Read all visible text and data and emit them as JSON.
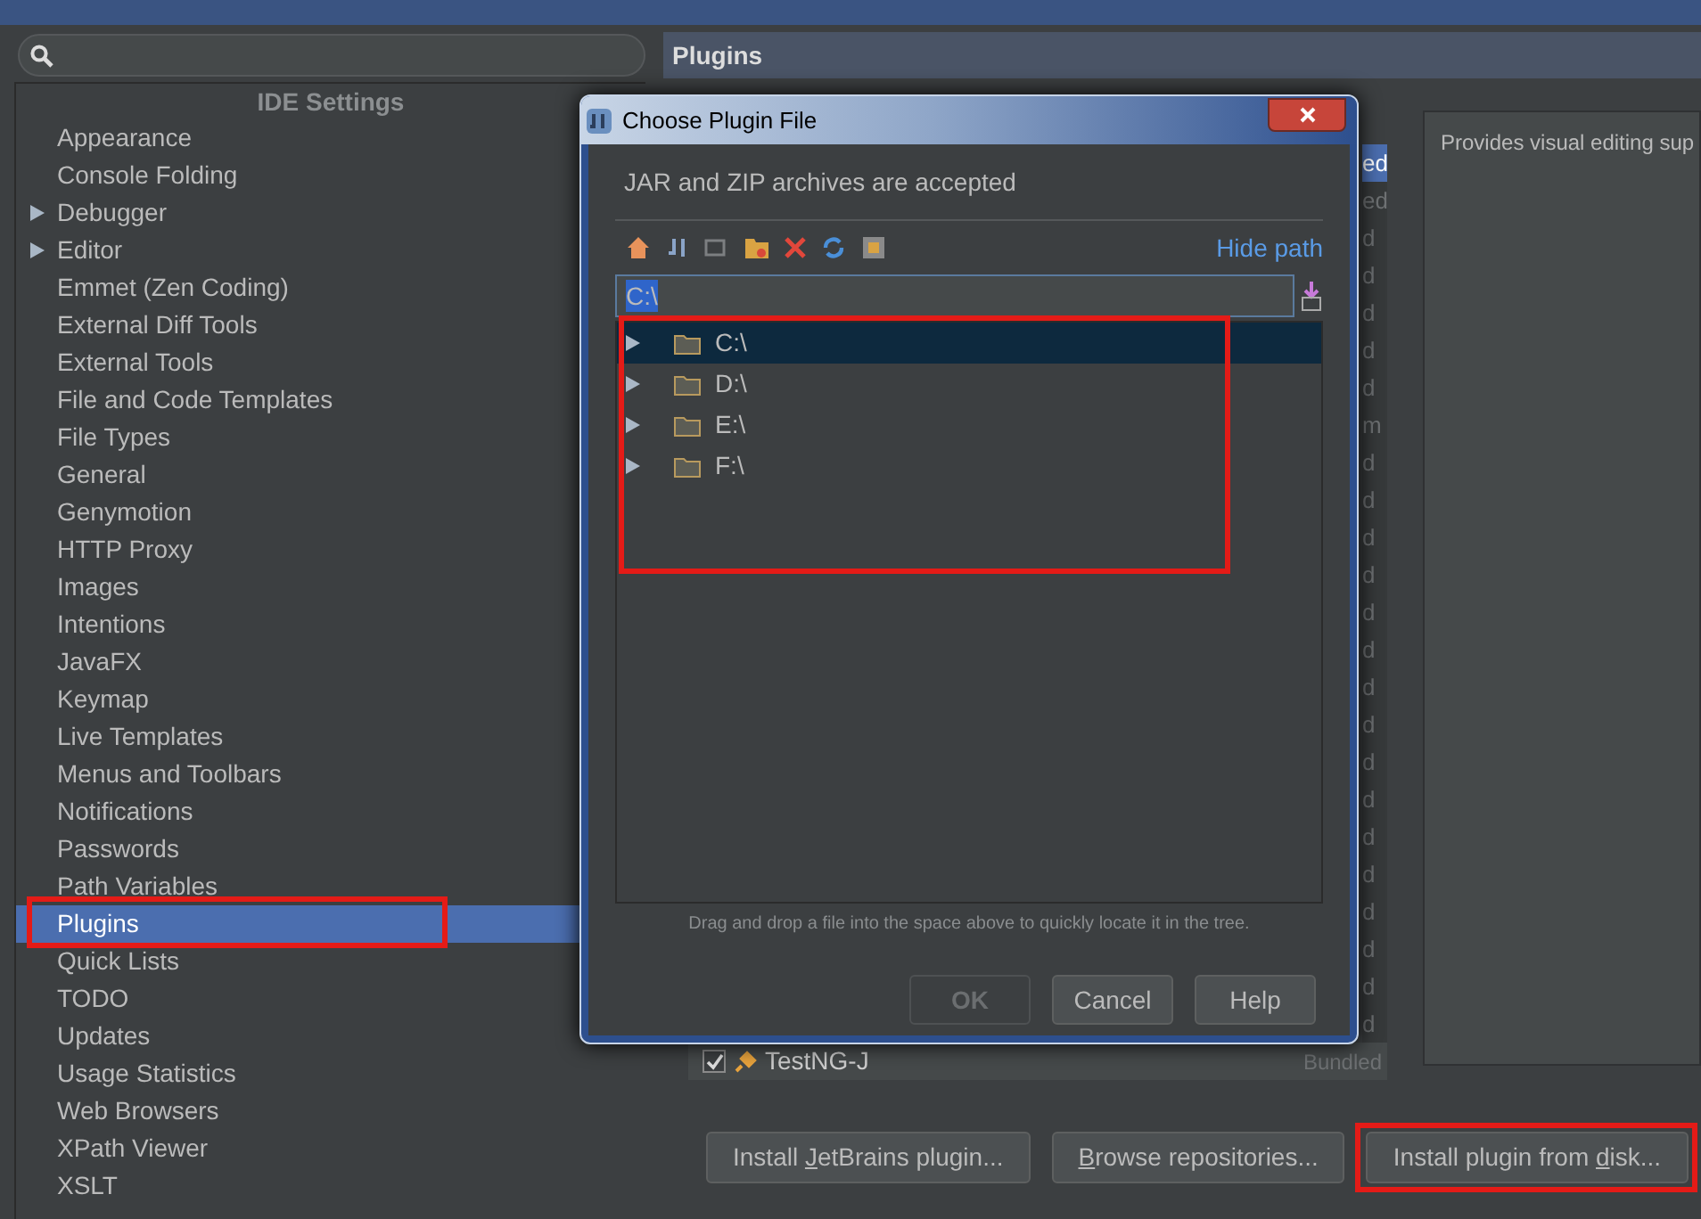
{
  "sidebar": {
    "header": "IDE Settings",
    "items": [
      {
        "label": "Appearance",
        "kind": "leaf",
        "selected": false
      },
      {
        "label": "Console Folding",
        "kind": "leaf",
        "selected": false
      },
      {
        "label": "Debugger",
        "kind": "group",
        "selected": false
      },
      {
        "label": "Editor",
        "kind": "group",
        "selected": false
      },
      {
        "label": "Emmet (Zen Coding)",
        "kind": "leaf",
        "selected": false
      },
      {
        "label": "External Diff Tools",
        "kind": "leaf",
        "selected": false
      },
      {
        "label": "External Tools",
        "kind": "leaf",
        "selected": false
      },
      {
        "label": "File and Code Templates",
        "kind": "leaf",
        "selected": false
      },
      {
        "label": "File Types",
        "kind": "leaf",
        "selected": false
      },
      {
        "label": "General",
        "kind": "leaf",
        "selected": false
      },
      {
        "label": "Genymotion",
        "kind": "leaf",
        "selected": false
      },
      {
        "label": "HTTP Proxy",
        "kind": "leaf",
        "selected": false
      },
      {
        "label": "Images",
        "kind": "leaf",
        "selected": false
      },
      {
        "label": "Intentions",
        "kind": "leaf",
        "selected": false
      },
      {
        "label": "JavaFX",
        "kind": "leaf",
        "selected": false
      },
      {
        "label": "Keymap",
        "kind": "leaf",
        "selected": false
      },
      {
        "label": "Live Templates",
        "kind": "leaf",
        "selected": false
      },
      {
        "label": "Menus and Toolbars",
        "kind": "leaf",
        "selected": false
      },
      {
        "label": "Notifications",
        "kind": "leaf",
        "selected": false
      },
      {
        "label": "Passwords",
        "kind": "leaf",
        "selected": false
      },
      {
        "label": "Path Variables",
        "kind": "leaf",
        "selected": false
      },
      {
        "label": "Plugins",
        "kind": "leaf",
        "selected": true
      },
      {
        "label": "Quick Lists",
        "kind": "leaf",
        "selected": false
      },
      {
        "label": "TODO",
        "kind": "leaf",
        "selected": false
      },
      {
        "label": "Updates",
        "kind": "leaf",
        "selected": false
      },
      {
        "label": "Usage Statistics",
        "kind": "leaf",
        "selected": false
      },
      {
        "label": "Web Browsers",
        "kind": "leaf",
        "selected": false
      },
      {
        "label": "XPath Viewer",
        "kind": "leaf",
        "selected": false
      },
      {
        "label": "XSLT",
        "kind": "leaf",
        "selected": false
      }
    ]
  },
  "panel": {
    "title": "Plugins",
    "plugin_fragments": [
      {
        "text": "ed",
        "selected": true
      },
      {
        "text": "ed",
        "selected": false
      },
      {
        "text": "d",
        "selected": false
      },
      {
        "text": "d",
        "selected": false
      },
      {
        "text": "d",
        "selected": false
      },
      {
        "text": "d",
        "selected": false
      },
      {
        "text": "d",
        "selected": false
      },
      {
        "text": "m",
        "selected": false
      },
      {
        "text": "d",
        "selected": false
      },
      {
        "text": "d",
        "selected": false
      },
      {
        "text": "d",
        "selected": false
      },
      {
        "text": "d",
        "selected": false
      },
      {
        "text": "d",
        "selected": false
      },
      {
        "text": "d",
        "selected": false
      },
      {
        "text": "d",
        "selected": false
      },
      {
        "text": "d",
        "selected": false
      },
      {
        "text": "d",
        "selected": false
      },
      {
        "text": "d",
        "selected": false
      },
      {
        "text": "d",
        "selected": false
      },
      {
        "text": "d",
        "selected": false
      },
      {
        "text": "d",
        "selected": false
      },
      {
        "text": "d",
        "selected": false
      },
      {
        "text": "d",
        "selected": false
      },
      {
        "text": "d",
        "selected": false
      }
    ],
    "plugins": [
      {
        "name": "TestNG-J",
        "status": "Bundled",
        "checked": true
      }
    ],
    "description": "Provides visual editing sup",
    "buttons": [
      {
        "before": "Install ",
        "mnemonic": "J",
        "after": "etBrains plugin..."
      },
      {
        "mnemonic": "B",
        "after": "rowse repositories..."
      },
      {
        "before": "Install plugin from ",
        "mnemonic": "d",
        "after": "isk..."
      }
    ]
  },
  "dialog": {
    "title": "Choose Plugin File",
    "message": "JAR and ZIP archives are accepted",
    "hide_path": "Hide path",
    "path": "C:\\",
    "tree": [
      {
        "label": "C:\\",
        "selected": true
      },
      {
        "label": "D:\\",
        "selected": false
      },
      {
        "label": "E:\\",
        "selected": false
      },
      {
        "label": "F:\\",
        "selected": false
      }
    ],
    "hint": "Drag and drop a file into the space above to quickly locate it in the tree.",
    "buttons": [
      {
        "label": "OK",
        "disabled": true
      },
      {
        "label": "Cancel",
        "disabled": false
      },
      {
        "label": "Help",
        "disabled": false
      }
    ]
  }
}
